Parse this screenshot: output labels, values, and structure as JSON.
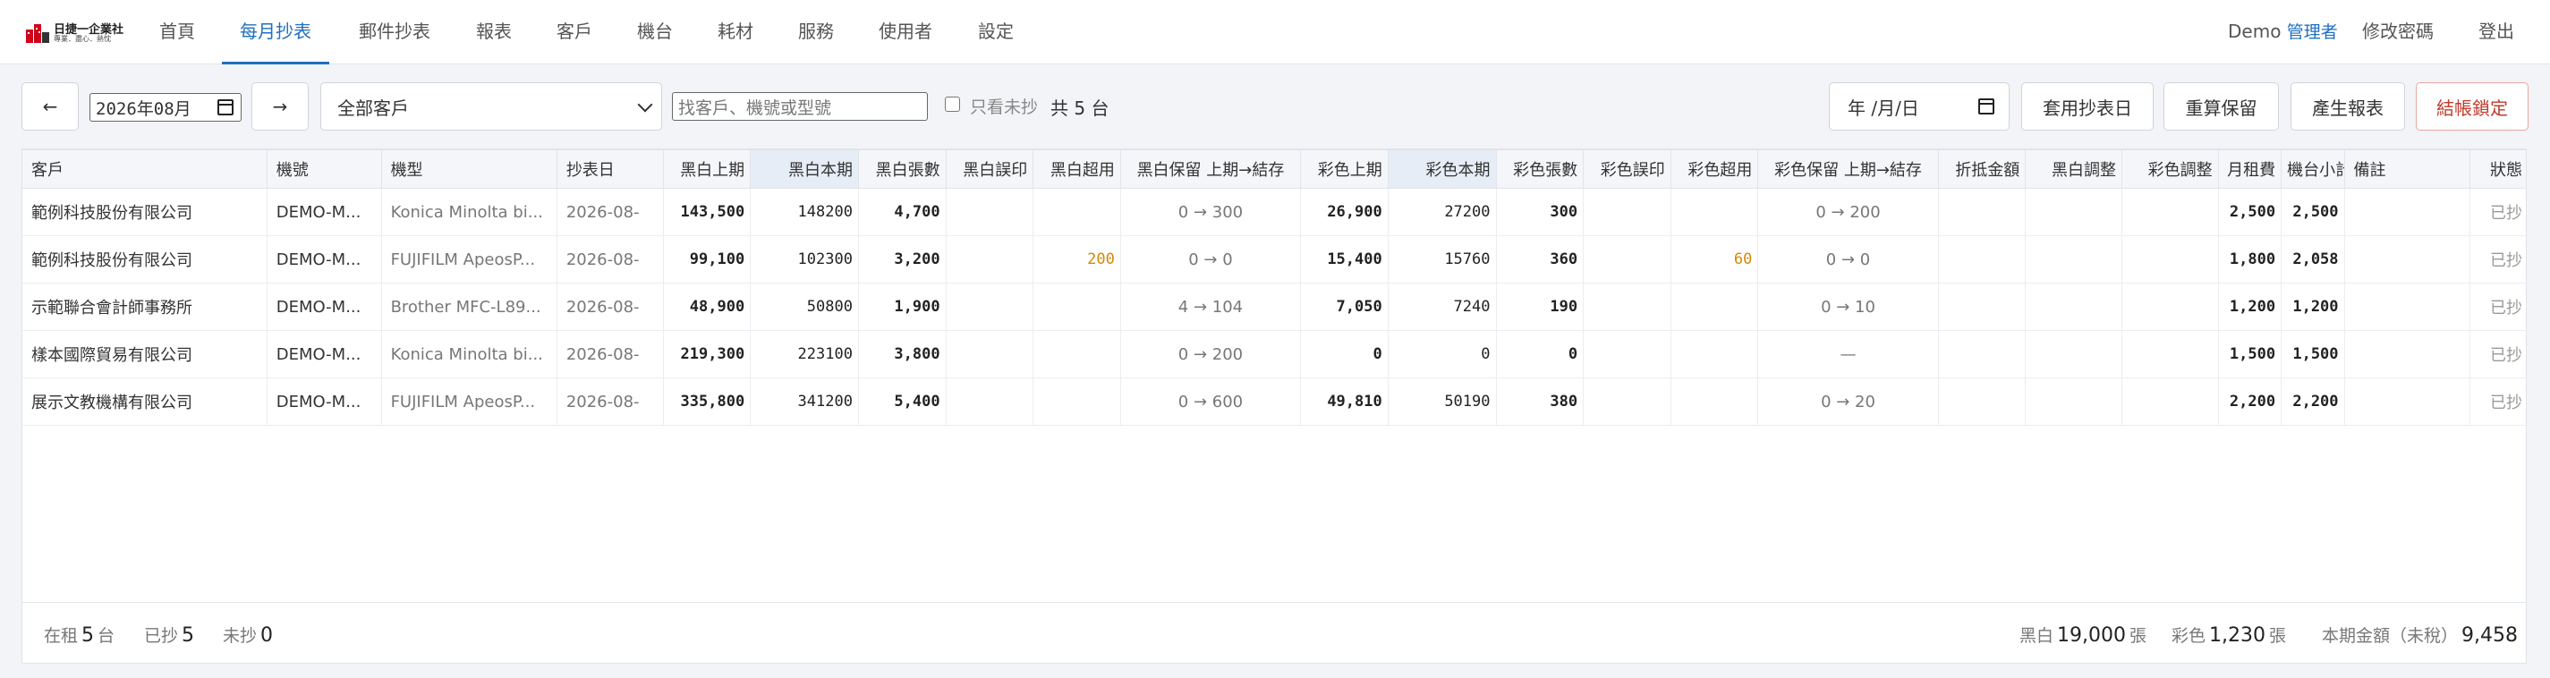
{
  "brand": {
    "name": "日捷一企業社",
    "tagline": "專業．盡心．熱忱"
  },
  "nav": {
    "tabs": [
      {
        "label": "首頁"
      },
      {
        "label": "每月抄表",
        "active": true
      },
      {
        "label": "郵件抄表"
      },
      {
        "label": "報表"
      },
      {
        "label": "客戶"
      },
      {
        "label": "機台"
      },
      {
        "label": "耗材"
      },
      {
        "label": "服務"
      },
      {
        "label": "使用者"
      },
      {
        "label": "設定"
      }
    ],
    "user_name": "Demo",
    "user_role": "管理者",
    "change_password": "修改密碼",
    "logout": "登出"
  },
  "toolbar": {
    "prev": "←",
    "month": "2026年08月",
    "next": "→",
    "customer_filter": "全部客戶",
    "search_placeholder": "找客戶、機號或型號",
    "unread_only_label": "只看未抄",
    "total": "共 5 台",
    "date_placeholder": "年 /月/日",
    "apply_date": "套用抄表日",
    "recalc": "重算保留",
    "generate_report": "產生報表",
    "lock": "結帳鎖定"
  },
  "table": {
    "headers": [
      "客戶",
      "機號",
      "機型",
      "抄表日",
      "黑白上期",
      "黑白本期",
      "黑白張數",
      "黑白誤印",
      "黑白超用",
      "黑白保留 上期→結存",
      "彩色上期",
      "彩色本期",
      "彩色張數",
      "彩色誤印",
      "彩色超用",
      "彩色保留 上期→結存",
      "折抵金額",
      "黑白調整",
      "彩色調整",
      "月租費",
      "機台小計",
      "備註",
      "狀態"
    ],
    "rows": [
      [
        "範例科技股份有限公司",
        "DEMO-M...",
        "Konica Minolta bi...",
        "2026-08-",
        "143,500",
        "148200",
        "4,700",
        "",
        "",
        "0 → 300",
        "26,900",
        "27200",
        "300",
        "",
        "",
        "0 → 200",
        "",
        "",
        "",
        "2,500",
        "2,500",
        "",
        "已抄"
      ],
      [
        "範例科技股份有限公司",
        "DEMO-M...",
        "FUJIFILM ApeosP...",
        "2026-08-",
        "99,100",
        "102300",
        "3,200",
        "",
        "200",
        "0 → 0",
        "15,400",
        "15760",
        "360",
        "",
        "60",
        "0 → 0",
        "",
        "",
        "",
        "1,800",
        "2,058",
        "",
        "已抄"
      ],
      [
        "示範聯合會計師事務所",
        "DEMO-M...",
        "Brother MFC-L89...",
        "2026-08-",
        "48,900",
        "50800",
        "1,900",
        "",
        "",
        "4 → 104",
        "7,050",
        "7240",
        "190",
        "",
        "",
        "0 → 10",
        "",
        "",
        "",
        "1,200",
        "1,200",
        "",
        "已抄"
      ],
      [
        "樣本國際貿易有限公司",
        "DEMO-M...",
        "Konica Minolta bi...",
        "2026-08-",
        "219,300",
        "223100",
        "3,800",
        "",
        "",
        "0 → 200",
        "0",
        "0",
        "0",
        "",
        "",
        "—",
        "",
        "",
        "",
        "1,500",
        "1,500",
        "",
        "已抄"
      ],
      [
        "展示文教機構有限公司",
        "DEMO-M...",
        "FUJIFILM ApeosP...",
        "2026-08-",
        "335,800",
        "341200",
        "5,400",
        "",
        "",
        "0 → 600",
        "49,810",
        "50190",
        "380",
        "",
        "",
        "0 → 20",
        "",
        "",
        "",
        "2,200",
        "2,200",
        "",
        "已抄"
      ]
    ]
  },
  "footer": {
    "rented_label": "在租",
    "rented_value": "5",
    "rented_unit": "台",
    "read_label": "已抄",
    "read_value": "5",
    "unread_label": "未抄",
    "unread_value": "0",
    "bw_label": "黑白",
    "bw_value": "19,000",
    "bw_unit": "張",
    "color_label": "彩色",
    "color_value": "1,230",
    "color_unit": "張",
    "amount_label": "本期金額（未稅）",
    "amount_value": "9,458"
  },
  "colors": {
    "accent": "#1f6fbf",
    "danger": "#c0392b",
    "overuse": "#d48806"
  }
}
